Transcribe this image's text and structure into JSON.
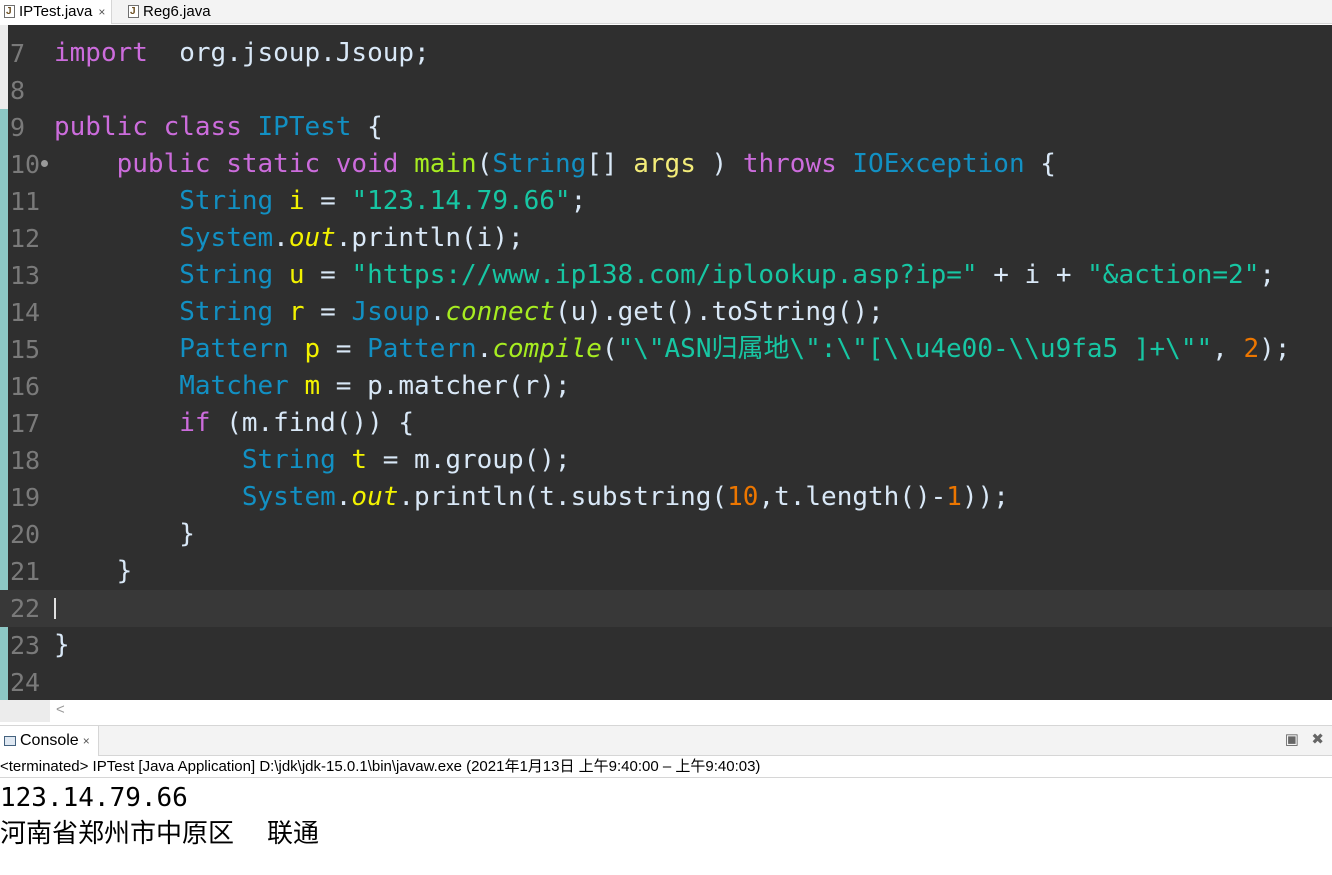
{
  "editor_tabs": [
    {
      "label": "IPTest.java",
      "active": true,
      "close": "×"
    },
    {
      "label": "Reg6.java",
      "active": false
    }
  ],
  "code_lines": [
    {
      "n": "7",
      "tokens": [
        [
          "kw",
          "import"
        ],
        [
          "",
          "  org.jsoup.Jsoup;"
        ]
      ]
    },
    {
      "n": "8",
      "tokens": []
    },
    {
      "n": "9",
      "tokens": [
        [
          "kw",
          "public"
        ],
        [
          "",
          " "
        ],
        [
          "kw",
          "class"
        ],
        [
          "",
          " "
        ],
        [
          "cls",
          "IPTest"
        ],
        [
          "",
          " {"
        ]
      ]
    },
    {
      "n": "10",
      "fold": true,
      "tokens": [
        [
          "",
          "    "
        ],
        [
          "kw",
          "public"
        ],
        [
          "",
          " "
        ],
        [
          "kw",
          "static"
        ],
        [
          "",
          " "
        ],
        [
          "kw",
          "void"
        ],
        [
          "",
          " "
        ],
        [
          "mth",
          "main"
        ],
        [
          "",
          "("
        ],
        [
          "ty",
          "String"
        ],
        [
          "",
          "[] "
        ],
        [
          "loc",
          "args"
        ],
        [
          "",
          " ) "
        ],
        [
          "kw",
          "throws"
        ],
        [
          "",
          " "
        ],
        [
          "ty",
          "IOException"
        ],
        [
          "",
          " {"
        ]
      ]
    },
    {
      "n": "11",
      "tokens": [
        [
          "",
          "        "
        ],
        [
          "ty",
          "String"
        ],
        [
          "",
          " "
        ],
        [
          "var",
          "i"
        ],
        [
          "",
          " = "
        ],
        [
          "str",
          "\"123.14.79.66\""
        ],
        [
          "",
          ";"
        ]
      ]
    },
    {
      "n": "12",
      "tokens": [
        [
          "",
          "        "
        ],
        [
          "ty",
          "System"
        ],
        [
          "",
          "."
        ],
        [
          "st",
          "out"
        ],
        [
          "",
          ".println(i);"
        ]
      ]
    },
    {
      "n": "13",
      "tokens": [
        [
          "",
          "        "
        ],
        [
          "ty",
          "String"
        ],
        [
          "",
          " "
        ],
        [
          "var",
          "u"
        ],
        [
          "",
          " = "
        ],
        [
          "str",
          "\"https://www.ip138.com/iplookup.asp?ip=\""
        ],
        [
          "",
          " + i + "
        ],
        [
          "str",
          "\"&action=2\""
        ],
        [
          "",
          ";"
        ]
      ]
    },
    {
      "n": "14",
      "tokens": [
        [
          "",
          "        "
        ],
        [
          "ty",
          "String"
        ],
        [
          "",
          " "
        ],
        [
          "var",
          "r"
        ],
        [
          "",
          " = "
        ],
        [
          "ty",
          "Jsoup"
        ],
        [
          "",
          "."
        ],
        [
          "smth",
          "connect"
        ],
        [
          "",
          "(u).get().toString();"
        ]
      ]
    },
    {
      "n": "15",
      "tokens": [
        [
          "",
          "        "
        ],
        [
          "ty",
          "Pattern"
        ],
        [
          "",
          " "
        ],
        [
          "var",
          "p"
        ],
        [
          "",
          " = "
        ],
        [
          "ty",
          "Pattern"
        ],
        [
          "",
          "."
        ],
        [
          "smth",
          "compile"
        ],
        [
          "",
          "("
        ],
        [
          "str",
          "\"\\\"ASN归属地\\\":\\\"[\\\\u4e00-\\\\u9fa5 ]+\\\"\""
        ],
        [
          "",
          ", "
        ],
        [
          "num",
          "2"
        ],
        [
          "",
          ");"
        ]
      ]
    },
    {
      "n": "16",
      "tokens": [
        [
          "",
          "        "
        ],
        [
          "ty",
          "Matcher"
        ],
        [
          "",
          " "
        ],
        [
          "var",
          "m"
        ],
        [
          "",
          " = p.matcher(r);"
        ]
      ]
    },
    {
      "n": "17",
      "tokens": [
        [
          "",
          "        "
        ],
        [
          "kw",
          "if"
        ],
        [
          "",
          " (m.find()) {"
        ]
      ]
    },
    {
      "n": "18",
      "tokens": [
        [
          "",
          "            "
        ],
        [
          "ty",
          "String"
        ],
        [
          "",
          " "
        ],
        [
          "var",
          "t"
        ],
        [
          "",
          " = m.group();"
        ]
      ]
    },
    {
      "n": "19",
      "tokens": [
        [
          "",
          "            "
        ],
        [
          "ty",
          "System"
        ],
        [
          "",
          "."
        ],
        [
          "st",
          "out"
        ],
        [
          "",
          ".println(t.substring("
        ],
        [
          "num",
          "10"
        ],
        [
          "",
          ",t.length()-"
        ],
        [
          "num",
          "1"
        ],
        [
          "",
          "));"
        ]
      ]
    },
    {
      "n": "20",
      "tokens": [
        [
          "",
          "        }"
        ]
      ]
    },
    {
      "n": "21",
      "tokens": [
        [
          "",
          "    }"
        ]
      ]
    },
    {
      "n": "22",
      "current": true,
      "tokens": []
    },
    {
      "n": "23",
      "tokens": [
        [
          "",
          "}"
        ]
      ]
    },
    {
      "n": "24",
      "tokens": []
    }
  ],
  "hscroll_arrow": "<",
  "console": {
    "tab_label": "Console",
    "close": "×",
    "minimize": "▣",
    "maximize_close": "✖",
    "status": "<terminated> IPTest [Java Application] D:\\jdk\\jdk-15.0.1\\bin\\javaw.exe  (2021年1月13日 上午9:40:00 – 上午9:40:03)",
    "output": [
      "123.14.79.66",
      "河南省郑州市中原区    联通"
    ]
  }
}
